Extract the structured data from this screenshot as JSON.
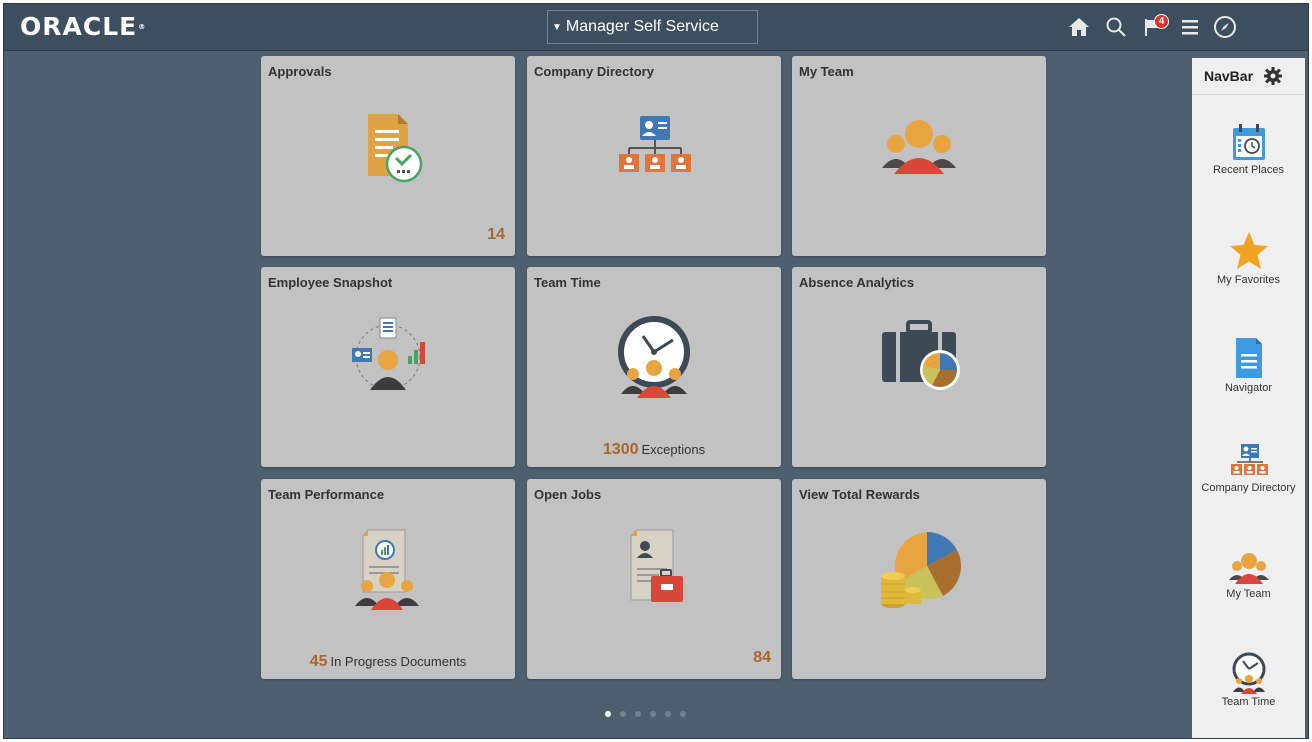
{
  "header": {
    "logo_text": "ORACLE",
    "homepage_selector": "Manager Self Service",
    "notification_count": "4",
    "icons": [
      "home-icon",
      "search-icon",
      "notifications-flag-icon",
      "actions-menu-icon",
      "navbar-compass-icon"
    ]
  },
  "tiles": [
    {
      "title": "Approvals",
      "count": "14",
      "count_label": "",
      "icon": "approvals-icon"
    },
    {
      "title": "Company Directory",
      "count": "",
      "count_label": "",
      "icon": "company-directory-icon"
    },
    {
      "title": "My Team",
      "count": "",
      "count_label": "",
      "icon": "my-team-icon"
    },
    {
      "title": "Employee Snapshot",
      "count": "",
      "count_label": "",
      "icon": "employee-snapshot-icon"
    },
    {
      "title": "Team Time",
      "count": "1300",
      "count_label": "Exceptions",
      "icon": "team-time-icon"
    },
    {
      "title": "Absence Analytics",
      "count": "",
      "count_label": "",
      "icon": "absence-analytics-icon"
    },
    {
      "title": "Team Performance",
      "count": "45",
      "count_label": "In Progress Documents",
      "icon": "team-performance-icon"
    },
    {
      "title": "Open Jobs",
      "count": "84",
      "count_label": "",
      "icon": "open-jobs-icon"
    },
    {
      "title": "View Total Rewards",
      "count": "",
      "count_label": "",
      "icon": "total-rewards-icon"
    }
  ],
  "pager": {
    "pages": 6,
    "current": 1
  },
  "navbar": {
    "title": "NavBar",
    "items": [
      {
        "label": "Recent Places",
        "icon": "recent-places-icon"
      },
      {
        "label": "My Favorites",
        "icon": "favorites-star-icon"
      },
      {
        "label": "Navigator",
        "icon": "navigator-icon"
      },
      {
        "label": "Company Directory",
        "icon": "company-directory-icon"
      },
      {
        "label": "My Team",
        "icon": "my-team-icon"
      },
      {
        "label": "Team Time",
        "icon": "team-time-icon"
      }
    ]
  },
  "colors": {
    "header": "#3d4f5e",
    "background": "#4e6070",
    "tile": "#c2c2c2",
    "count": "#a8672e",
    "badge": "#d9342b",
    "navbar": "#efefef"
  }
}
